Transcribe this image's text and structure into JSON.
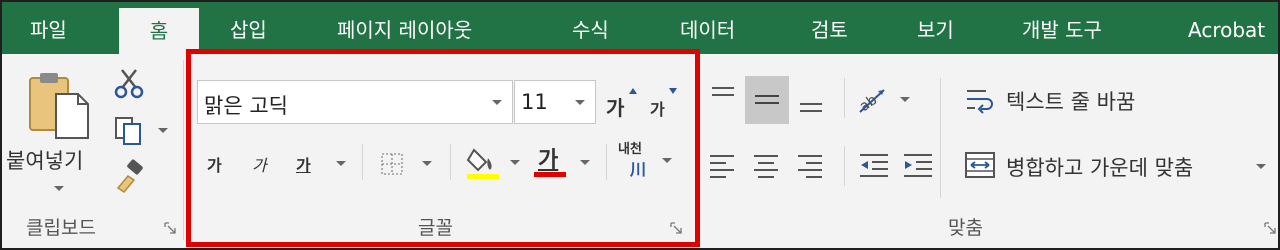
{
  "tabs": [
    {
      "label": "파일",
      "active": false
    },
    {
      "label": "홈",
      "active": true
    },
    {
      "label": "삽입",
      "active": false
    },
    {
      "label": "페이지 레이아웃",
      "active": false
    },
    {
      "label": "수식",
      "active": false
    },
    {
      "label": "데이터",
      "active": false
    },
    {
      "label": "검토",
      "active": false
    },
    {
      "label": "보기",
      "active": false
    },
    {
      "label": "개발 도구",
      "active": false
    },
    {
      "label": "Acrobat",
      "active": false
    }
  ],
  "clipboard": {
    "paste_label": "붙여넣기",
    "group_label": "클립보드"
  },
  "font": {
    "font_name": "맑은 고딕",
    "font_size": "11",
    "grow_glyph": "가",
    "shrink_glyph": "가",
    "bold_glyph": "가",
    "italic_glyph": "가",
    "underline_glyph": "가",
    "font_color_glyph": "가",
    "phonetic_glyph_top": "내천",
    "phonetic_glyph_bottom": "川",
    "group_label": "글꼴",
    "fill_color": "#ffff00",
    "font_color": "#e00000"
  },
  "alignment": {
    "wrap_text_label": "텍스트 줄 바꿈",
    "merge_center_label": "병합하고 가운데 맞춤",
    "group_label": "맞춤"
  },
  "colors": {
    "tab_bar": "#217346",
    "ribbon_bg": "#f3f3f3",
    "highlight": "#e00000",
    "accent_blue": "#2b579a"
  }
}
